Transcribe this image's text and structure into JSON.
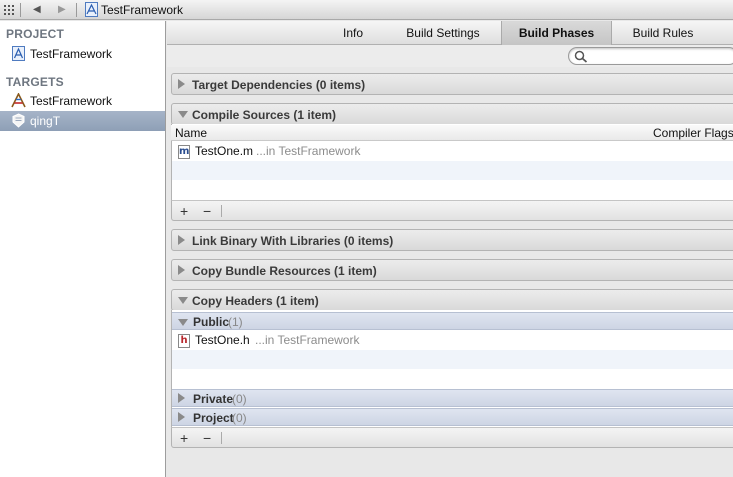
{
  "jumpbar": {
    "title": "TestFramework"
  },
  "navigator": {
    "project_heading": "PROJECT",
    "project_item": "TestFramework",
    "targets_heading": "TARGETS",
    "targets": [
      {
        "label": "TestFramework",
        "icon": "app-target-icon",
        "selected": false
      },
      {
        "label": "qingT",
        "icon": "framework-target-icon",
        "selected": true
      }
    ]
  },
  "tabs": [
    "Info",
    "Build Settings",
    "Build Phases",
    "Build Rules"
  ],
  "active_tab": "Build Phases",
  "search": {
    "placeholder": ""
  },
  "phases": {
    "target_dependencies": "Target Dependencies (0 items)",
    "compile_sources": "Compile Sources (1 item)",
    "link_binary": "Link Binary With Libraries (0 items)",
    "copy_bundle": "Copy Bundle Resources (1 item)",
    "copy_headers": "Copy Headers (1 item)"
  },
  "compile_sources": {
    "col_name": "Name",
    "col_flags": "Compiler Flags",
    "files": [
      {
        "name": "TestOne.m",
        "location": "...in TestFramework",
        "icon_letter": "m"
      }
    ]
  },
  "copy_headers": {
    "public": {
      "title": "Public",
      "count": "(1)"
    },
    "public_files": [
      {
        "name": "TestOne.h",
        "location": "...in TestFramework",
        "icon_letter": "h"
      }
    ],
    "private": {
      "title": "Private",
      "count": "(0)"
    },
    "project": {
      "title": "Project",
      "count": "(0)"
    }
  },
  "footer_buttons": {
    "add": "+",
    "remove": "−"
  },
  "colors": {
    "selection": "#8e9fb6",
    "nav_heading": "#6e7680",
    "header_icon_red": "#b8282d",
    "source_icon_blue": "#2a4d8f"
  }
}
